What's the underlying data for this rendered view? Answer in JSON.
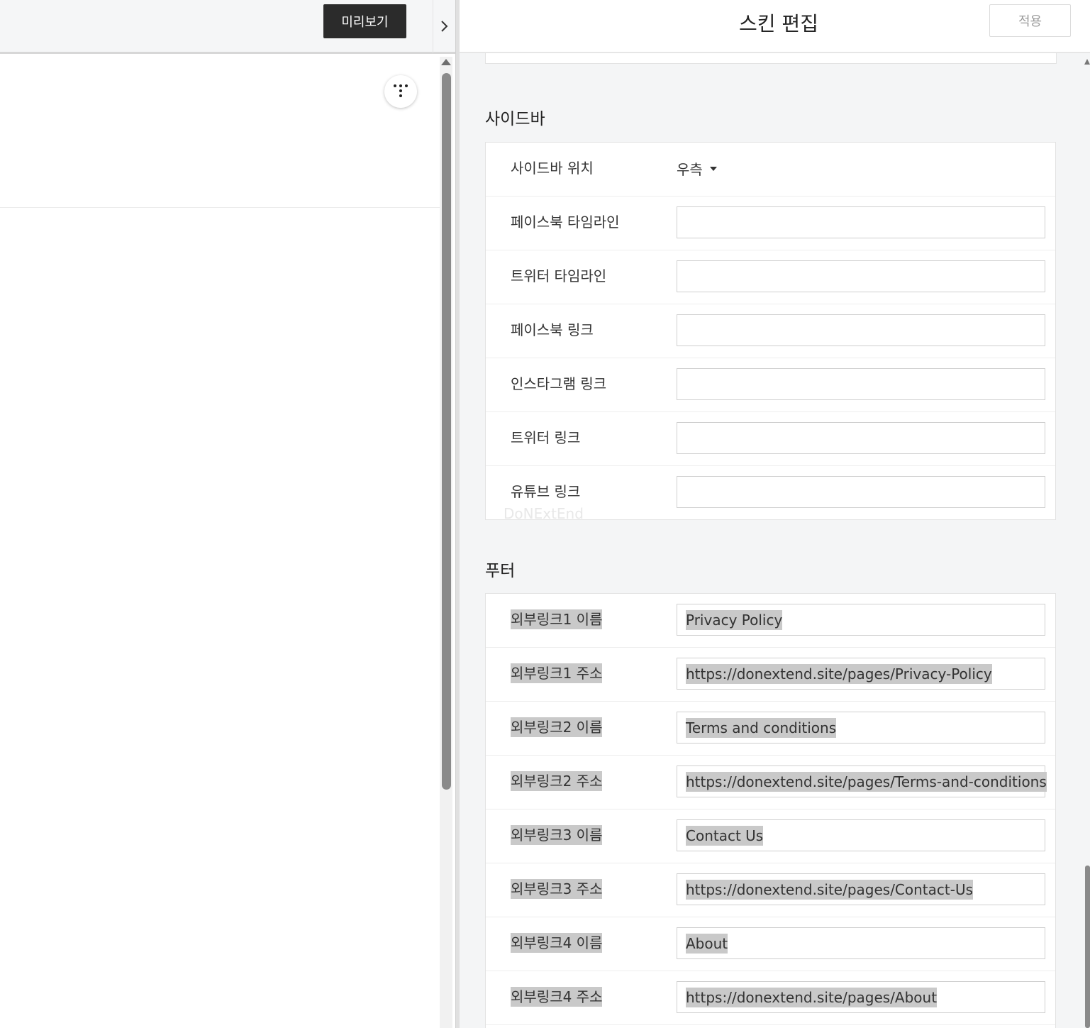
{
  "preview": {
    "button_label": "미리보기"
  },
  "editor": {
    "title": "스킨 편집",
    "apply_label": "적용"
  },
  "sidebar_section": {
    "title": "사이드바",
    "position_label": "사이드바 위치",
    "position_value": "우측",
    "fields": [
      {
        "label": "페이스북 타임라인",
        "value": ""
      },
      {
        "label": "트위터 타임라인",
        "value": ""
      },
      {
        "label": "페이스북 링크",
        "value": ""
      },
      {
        "label": "인스타그램 링크",
        "value": ""
      },
      {
        "label": "트위터 링크",
        "value": ""
      },
      {
        "label": "유튜브 링크",
        "value": ""
      }
    ]
  },
  "watermark": "DoNExtEnd",
  "footer_section": {
    "title": "푸터",
    "fields": [
      {
        "label": "외부링크1 이름",
        "value": "Privacy Policy"
      },
      {
        "label": "외부링크1 주소",
        "value": "https://donextend.site/pages/Privacy-Policy"
      },
      {
        "label": "외부링크2 이름",
        "value": "Terms and conditions"
      },
      {
        "label": "외부링크2 주소",
        "value": "https://donextend.site/pages/Terms-and-conditions"
      },
      {
        "label": "외부링크3 이름",
        "value": "Contact Us"
      },
      {
        "label": "외부링크3 주소",
        "value": "https://donextend.site/pages/Contact-Us"
      },
      {
        "label": "외부링크4 이름",
        "value": "About"
      },
      {
        "label": "외부링크4 주소",
        "value": "https://donextend.site/pages/About"
      }
    ]
  },
  "icons": {
    "collapse": "chevron-right-icon",
    "menu": "dots-menu-icon",
    "dropdown": "caret-down-icon"
  }
}
